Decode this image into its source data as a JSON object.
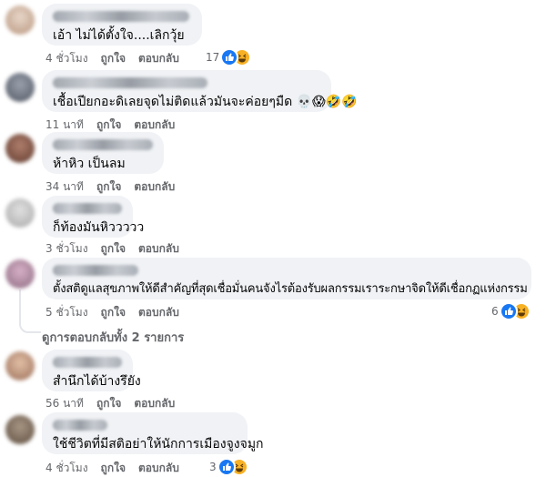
{
  "comments": [
    {
      "text": "เอ้า  ไม่ได้ตั้งใจ....เลิกวุ้ย",
      "time": "4 ชั่วโมง",
      "like": "ถูกใจ",
      "reply": "ตอบกลับ",
      "reactions": "17",
      "avatar_color": "#d8c2b0"
    },
    {
      "text": "เชื้อเปียกอะดิเลยจุดไม่ติดแล้วมันจะค่อยๆมืด 💀😱🤣🤣",
      "time": "11 นาที",
      "like": "ถูกใจ",
      "reply": "ตอบกลับ",
      "avatar_color": "#6e7480"
    },
    {
      "text": "ห้าหิว เป็นลม",
      "time": "34 นาที",
      "like": "ถูกใจ",
      "reply": "ตอบกลับ",
      "avatar_color": "#8a5b4a"
    },
    {
      "text": "ก็ท้องมันหิววววว",
      "time": "3 ชั่วโมง",
      "like": "ถูกใจ",
      "reply": "ตอบกลับ",
      "avatar_color": "#c8c8c8"
    },
    {
      "text": "ตั้งสติดูแลสุขภาพให้ดีสำคัญที่สุดเชื่อมั่นคนจังไรต้องรับผลกรรมเราระกษาจิดให้ดีเชื่อกฏแห่งกรรม",
      "time": "5 ชั่วโมง",
      "like": "ถูกใจ",
      "reply": "ตอบกลับ",
      "reactions": "6",
      "avatar_color": "#b98aa6"
    },
    {
      "text": "สำนึกได้บ้างรึยัง",
      "time": "56 นาที",
      "like": "ถูกใจ",
      "reply": "ตอบกลับ",
      "avatar_color": "#c9a08a"
    },
    {
      "text": "ใช้ชีวิตที่มีสติอย่าให้นักการเมืองจูงจมูก",
      "time": "4 ชั่วโมง",
      "like": "ถูกใจ",
      "reply": "ตอบกลับ",
      "reactions": "3",
      "avatar_color": "#7a6a5a"
    }
  ],
  "thread": {
    "view_replies": "ดูการตอบกลับทั้ง 2 รายการ"
  },
  "colors": {
    "bubble": "#f0f2f5",
    "meta": "#65676b",
    "like": "#1877f2",
    "haha": "#f7b125"
  }
}
